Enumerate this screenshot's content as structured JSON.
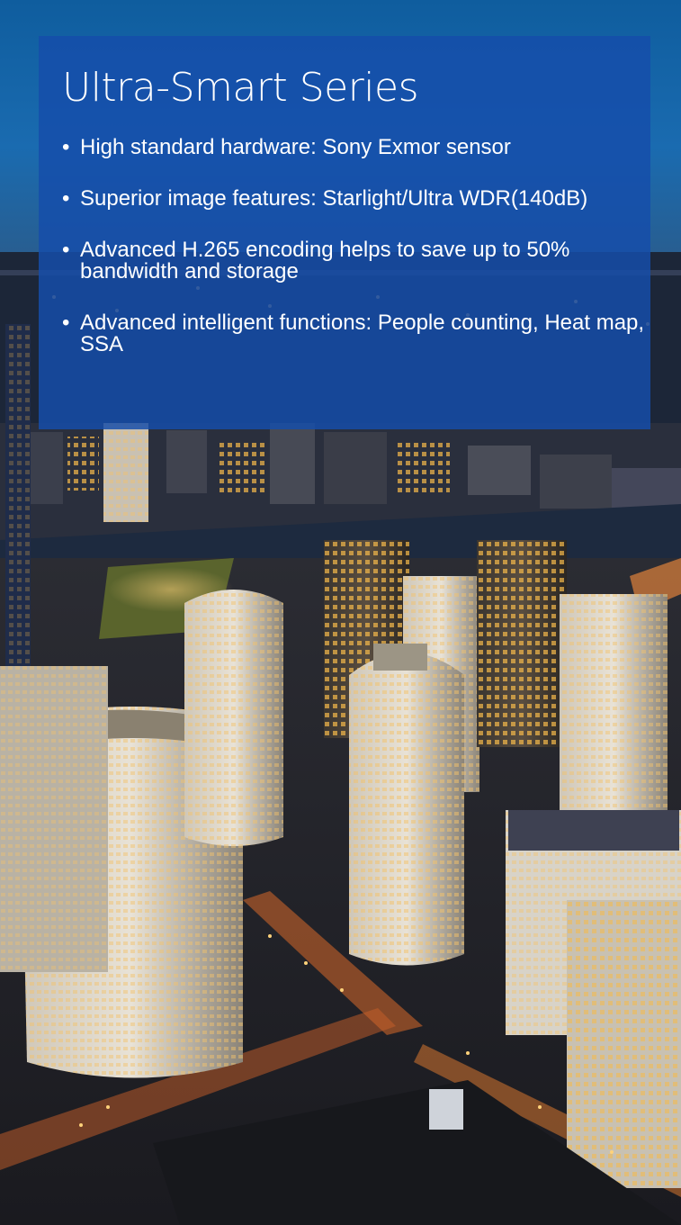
{
  "slide": {
    "title": "Ultra-Smart Series",
    "bullet_glyph": "•",
    "bullets": [
      "High standard hardware: Sony Exmor sensor",
      "Superior image features: Starlight/Ultra WDR(140dB)",
      "Advanced H.265 encoding helps to save up to 50% bandwidth and storage",
      "Advanced intelligent functions: People counting, Heat map, SSA"
    ]
  },
  "colors": {
    "panel": "#164eaa",
    "sky_top": "#0f5d9e",
    "text": "#ffffff"
  },
  "background": {
    "icon": "city-skyline-night-photo"
  }
}
